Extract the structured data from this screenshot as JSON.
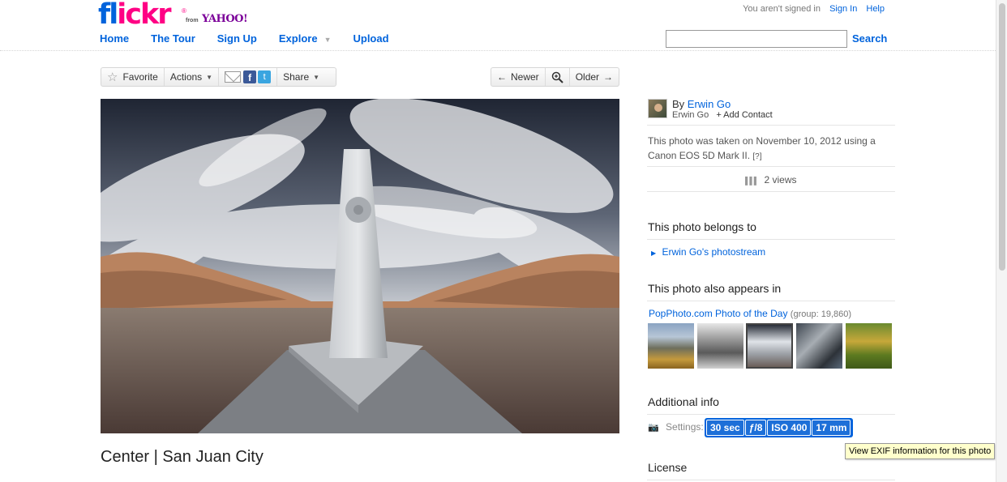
{
  "header": {
    "logo": {
      "word_a": "fl",
      "word_b": "ickr",
      "from": "from",
      "yahoo": "YAHOO!"
    },
    "nav": [
      {
        "label": "Home"
      },
      {
        "label": "The Tour"
      },
      {
        "label": "Sign Up"
      },
      {
        "label": "Explore"
      },
      {
        "label": "Upload"
      }
    ],
    "status_text": "You aren't signed in",
    "sign_in": "Sign In",
    "help": "Help",
    "search_value": "",
    "search_label": "Search"
  },
  "toolbar": {
    "favorite": "Favorite",
    "actions": "Actions",
    "share": "Share",
    "newer": "Newer",
    "older": "Older"
  },
  "photo": {
    "title": "Center | San Juan City"
  },
  "sidebar": {
    "by_prefix": "By",
    "author": "Erwin Go",
    "author_sub": "Erwin Go",
    "add_contact": "+ Add Contact",
    "taken_line1": "This photo was taken on November 10, 2012 using a",
    "taken_line2": "Canon EOS 5D Mark II.",
    "help_mark": "[?]",
    "views": "2 views",
    "belongs_heading": "This photo belongs to",
    "photostream_link": "Erwin Go's photostream",
    "appears_heading": "This photo also appears in",
    "group_link": "PopPhoto.com Photo of the Day",
    "group_count": "(group: 19,860)",
    "additional_heading": "Additional info",
    "settings_label": "Settings:",
    "exif": [
      "30 sec",
      "ƒ/8",
      "ISO 400",
      "17 mm"
    ],
    "license_heading": "License",
    "tooltip": "View EXIF information for this photo"
  },
  "colors": {
    "link": "#0063dc",
    "flickr_pink": "#ff0084",
    "yahoo_purple": "#7b0099",
    "exif_blue": "#1d6fd8",
    "tooltip_bg": "#ffffcc"
  }
}
